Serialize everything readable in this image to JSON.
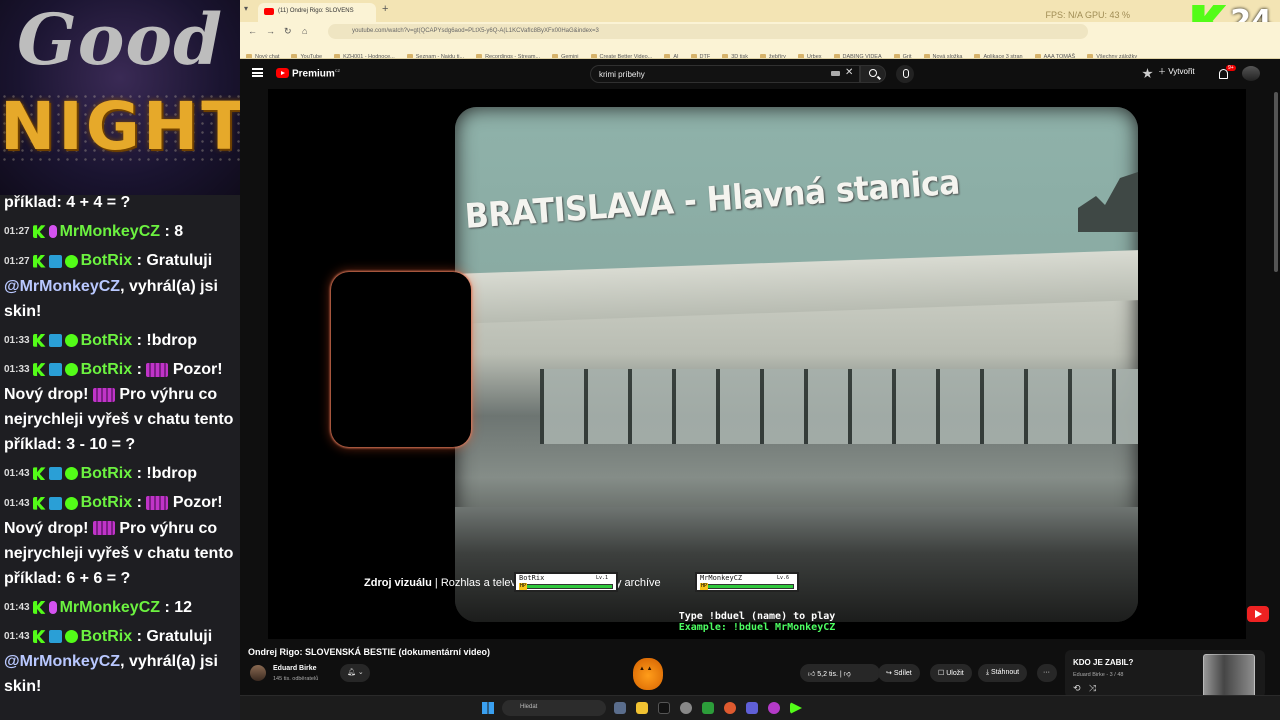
{
  "overlay": {
    "good": "Good",
    "night": "NIGHT",
    "kick_counter": "24"
  },
  "chat": [
    {
      "time": "",
      "user": "",
      "text": "příklad: 4 + 4 = ?"
    },
    {
      "time": "01:27",
      "user": "MrMonkeyCZ",
      "sep": " : ",
      "text": "8"
    },
    {
      "time": "01:27",
      "user": "BotRix",
      "sep": " : ",
      "text": "Gratuluji ",
      "mention": "@MrMonkeyCZ",
      "tail": ", vyhrál(a) jsi skin!"
    },
    {
      "time": "01:33",
      "user": "BotRix",
      "sep": " : ",
      "text": "!bdrop"
    },
    {
      "time": "01:33",
      "user": "BotRix",
      "sep": " : ",
      "text": "Pozor! Nový drop! ",
      "tail": "Pro výhru co nejrychleji vyřeš v chatu tento příklad: 3 - 10 = ?"
    },
    {
      "time": "01:43",
      "user": "BotRix",
      "sep": " : ",
      "text": "!bdrop"
    },
    {
      "time": "01:43",
      "user": "BotRix",
      "sep": " : ",
      "text": "Pozor! Nový drop! ",
      "tail": "Pro výhru co nejrychleji vyřeš v chatu tento příklad: 6 + 6 = ?"
    },
    {
      "time": "01:43",
      "user": "MrMonkeyCZ",
      "sep": " : ",
      "text": "12"
    },
    {
      "time": "01:43",
      "user": "BotRix",
      "sep": " : ",
      "text": "Gratuluji ",
      "mention": "@MrMonkeyCZ",
      "tail": ", vyhrál(a) jsi skin!"
    }
  ],
  "browser": {
    "tab_title": "(11) Ondrej Rigo: SLOVENS",
    "new_tab": "+",
    "url": "youtube.com/watch?v=gt(QCAPYsdg6aod=PLtX5-y6Q-A(L1KCVafIc8ByXFx00HaG&index=3",
    "sysinfo": "FPS: N/A    GPU: 43 %",
    "bookmarks": [
      "Nový chat",
      "YouTube",
      "KZH001 - Hodnoce...",
      "Seznam - Najdu ti...",
      "Recordings - Stream...",
      "Gemini",
      "Create Better Video...",
      "AI",
      "DTF",
      "3D tisk",
      "žebříry",
      "Urbex",
      "DABING VIDEA",
      "Grit",
      "Nová složka",
      "Aplikace 3 stran",
      "AAA TOMÁŠ",
      "Všechny záložky"
    ]
  },
  "youtube": {
    "brand": "Premium",
    "brand_country": "CZ",
    "search_query": "krimi príbehy",
    "create_label": "Vytvořit",
    "notif_count": "9+",
    "video_title": "Ondrej Rigo: SLOVENSKÁ BESTIE (dokumentární video)",
    "channel_name": "Eduard Birke",
    "channel_subs": "145 tis. odběratelů",
    "likes": "5,2 tis.",
    "share": "Sdílet",
    "save": "Uložit",
    "download": "Stáhnout",
    "next_title": "KDO JE ZABIL?",
    "next_meta": "Eduard Birke - 3 / 48"
  },
  "video": {
    "sign_text": "BRATISLAVA - Hlavná stanica",
    "credit_bold": "Zdroj vizuálu",
    "credit_rest": " | Rozhlas a telev",
    "credit_tail": "y archíve",
    "duel": [
      {
        "name": "BotRix",
        "level": "Lv.1",
        "hp": 1.0
      },
      {
        "name": "MrMonkeyCZ",
        "level": "Lv.6",
        "hp": 1.0
      }
    ],
    "duel_help_1": "Type !bduel (name) to play",
    "duel_help_2": "Example: !bduel MrMonkeyCZ"
  },
  "taskbar": {
    "search": "Hledat"
  }
}
